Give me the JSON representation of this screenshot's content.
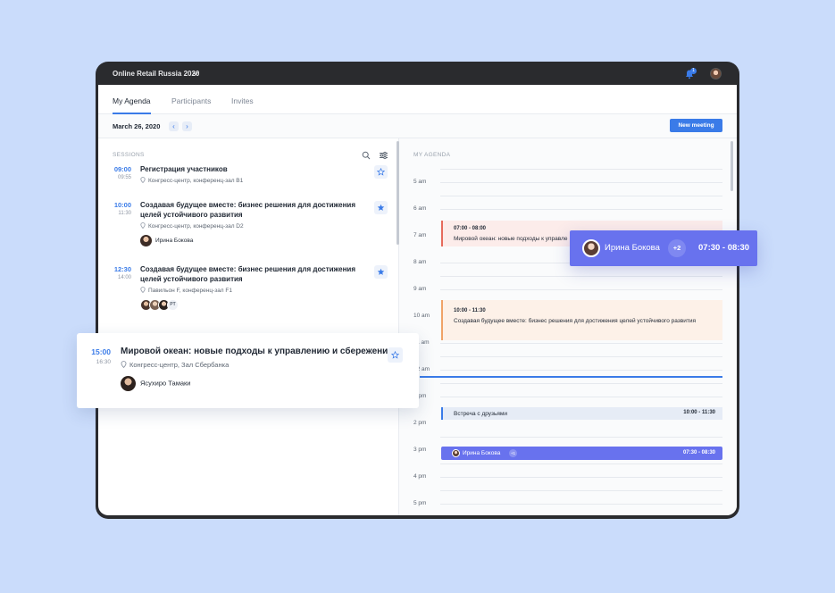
{
  "app": {
    "title": "Online Retail Russia 2020",
    "notification_count": "1"
  },
  "tabs": [
    {
      "label": "My Agenda"
    },
    {
      "label": "Participants"
    },
    {
      "label": "Invites"
    }
  ],
  "datebar": {
    "date": "March 26, 2020",
    "prev": "‹",
    "next": "›",
    "new_meeting": "New meeting"
  },
  "sessions": {
    "header": "SESSIONS",
    "items": [
      {
        "start": "09:00",
        "end": "09:55",
        "title": "Регистрация участников",
        "location": "Конгресс-центр, конференц-зал B1"
      },
      {
        "start": "10:00",
        "end": "11:30",
        "title": "Создавая будущее вместе: бизнес решения для достижения целей устойчивого развития",
        "location": "Конгресс-центр, конференц-зал D2",
        "person": "Ирина Бокова"
      },
      {
        "start": "12:30",
        "end": "14:00",
        "title": "Создавая будущее вместе: бизнес решения для достижения целей устойчивого развития",
        "location": "Павильон F, конференц-зал F1",
        "avatar_more": "PT"
      }
    ]
  },
  "floating_session": {
    "start": "15:00",
    "end": "16:30",
    "title": "Мировой океан: новые подходы к управлению и сбережению",
    "location": "Конгресс-центр, Зал Сбербанка",
    "person": "Ясухиро Тамаки"
  },
  "agenda": {
    "header": "MY AGENDA",
    "hours": [
      "5 am",
      "6 am",
      "7 am",
      "8 am",
      "9 am",
      "10 am",
      "11 am",
      "12 am",
      "1 pm",
      "2 pm",
      "3 pm",
      "4 pm",
      "5 pm"
    ],
    "events": {
      "red": {
        "time": "07:00 - 08:00",
        "title": "Мировой океан: новые подходы к управле"
      },
      "orange": {
        "time": "10:00 - 11:30",
        "title": "Создавая будущее вместе: бизнес решения для достижения целей устойчивого развития"
      },
      "blue": {
        "title": "Встреча с друзьями",
        "time": "10:00 - 11:30"
      },
      "purple": {
        "name": "Ирина Бокова",
        "plus": "+1",
        "time": "07:30 - 08:30"
      }
    }
  },
  "floating_tag": {
    "name": "Ирина Бокова",
    "plus": "+2",
    "time": "07:30 - 08:30"
  },
  "colors": {
    "accent": "#3a7be8",
    "purple": "#6872ee",
    "background": "#cadcfb"
  }
}
